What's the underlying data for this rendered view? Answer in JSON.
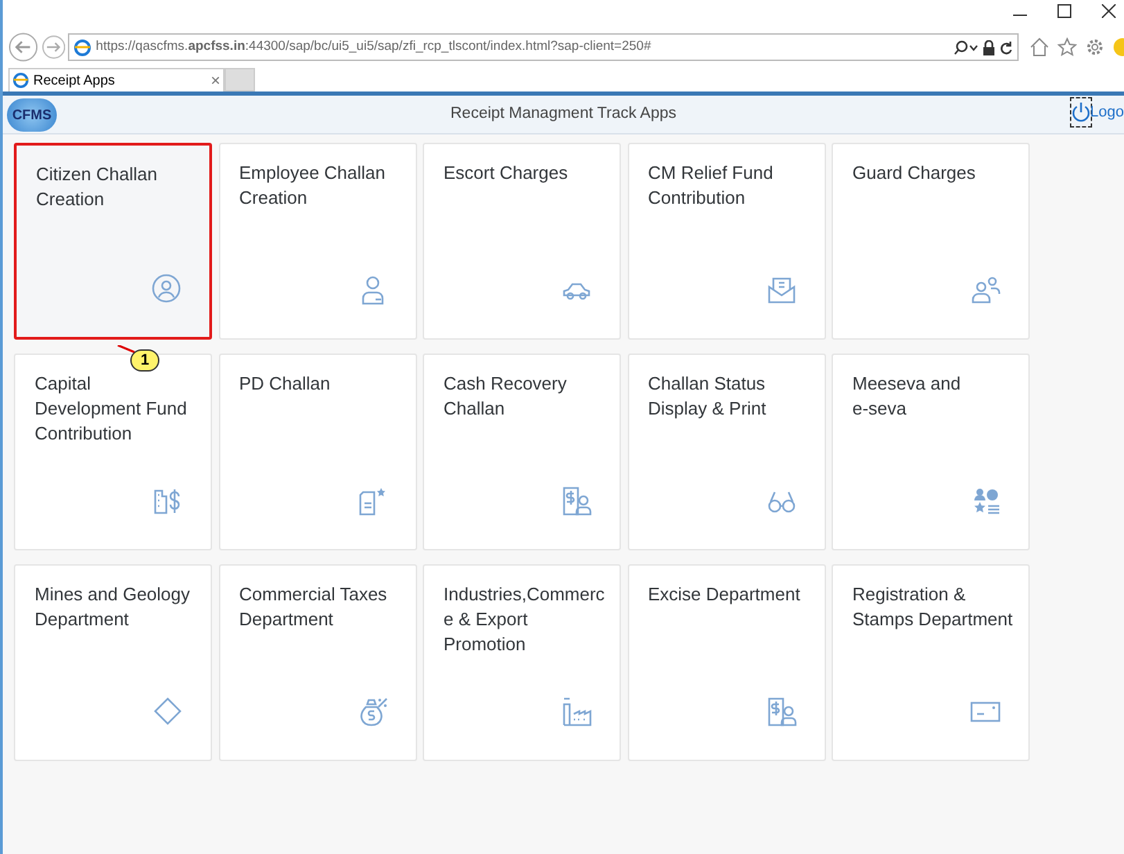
{
  "browser": {
    "url": "https://qascfms.**apcfss.in**:44300/sap/bc/ui5_ui5/sap/zfi_rcp_tlscont/index.html?sap-client=250#",
    "tab": {
      "label": "Receipt Apps",
      "close": "×",
      "selected": true
    }
  },
  "header": {
    "logo": "CFMS",
    "title": "Receipt Managment Track Apps",
    "logoff": "Logo"
  },
  "tiles": [
    {
      "title_lines": [
        "Citizen Challan",
        "Creation"
      ],
      "highlighted": true
    },
    {
      "title_lines": [
        "Employee Challan",
        "Creation"
      ],
      "highlighted": false
    },
    {
      "title_lines": [
        "Escort Charges"
      ],
      "highlighted": false
    },
    {
      "title_lines": [
        "CM Relief Fund",
        "Contribution"
      ],
      "highlighted": false
    },
    {
      "title_lines": [
        "Guard Charges"
      ],
      "highlighted": false
    },
    {
      "title_lines": [
        "Capital",
        "Development Fund",
        "Contribution"
      ],
      "highlighted": false
    },
    {
      "title_lines": [
        "PD Challan"
      ],
      "highlighted": false
    },
    {
      "title_lines": [
        "Cash Recovery",
        "Challan"
      ],
      "highlighted": false
    },
    {
      "title_lines": [
        "Challan Status",
        "Display & Print"
      ],
      "highlighted": false
    },
    {
      "title_lines": [
        "Meeseva and",
        "e-seva"
      ],
      "highlighted": false
    },
    {
      "title_lines": [
        "Mines and Geology",
        "Department"
      ],
      "highlighted": false
    },
    {
      "title_lines": [
        "Commercial Taxes",
        "Department"
      ],
      "highlighted": false
    },
    {
      "title_lines": [
        "Industries,Commerc",
        "e & Export",
        "Promotion"
      ],
      "highlighted": false
    },
    {
      "title_lines": [
        "Excise Department"
      ],
      "highlighted": false
    },
    {
      "title_lines": [
        "Registration &",
        "Stamps Department"
      ],
      "highlighted": false
    }
  ],
  "callout": {
    "label": "1"
  }
}
